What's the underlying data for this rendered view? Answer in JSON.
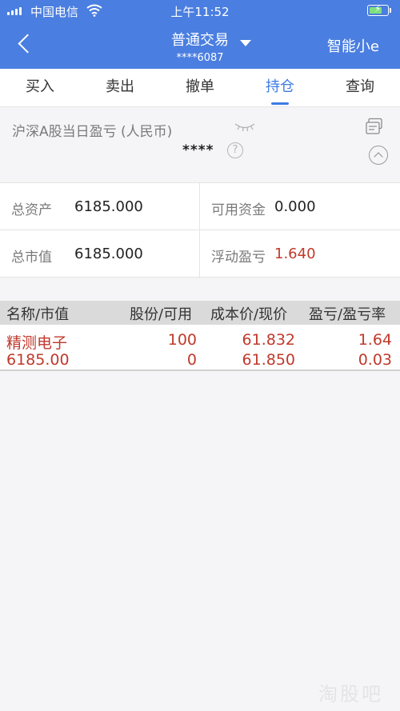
{
  "status_bar": {
    "carrier": "中国电信",
    "time": "上午11:52"
  },
  "nav": {
    "title": "普通交易",
    "account": "****6087",
    "right_label": "智能小e"
  },
  "tabs": [
    {
      "label": "买入"
    },
    {
      "label": "卖出"
    },
    {
      "label": "撤单"
    },
    {
      "label": "持仓",
      "active": true
    },
    {
      "label": "查询"
    }
  ],
  "pnl": {
    "label": "沪深A股当日盈亏 (人民币)",
    "value": "****"
  },
  "assets": {
    "total_assets_label": "总资产",
    "total_assets": "6185.000",
    "available_funds_label": "可用资金",
    "available_funds": "0.000",
    "market_value_label": "总市值",
    "market_value": "6185.000",
    "floating_pnl_label": "浮动盈亏",
    "floating_pnl": "1.640"
  },
  "holdings": {
    "headers": [
      "名称/市值",
      "股份/可用",
      "成本价/现价",
      "盈亏/盈亏率"
    ],
    "rows": [
      {
        "name": "精测电子",
        "market_value": "6185.00",
        "shares": "100",
        "available": "0",
        "cost_price": "61.832",
        "current_price": "61.850",
        "pnl": "1.64",
        "pnl_rate": "0.03"
      }
    ]
  },
  "watermark": "淘股吧",
  "colors": {
    "header_blue": "#4a7ee0",
    "active_tab": "#3d7be3",
    "gain_red": "#c0392b"
  }
}
